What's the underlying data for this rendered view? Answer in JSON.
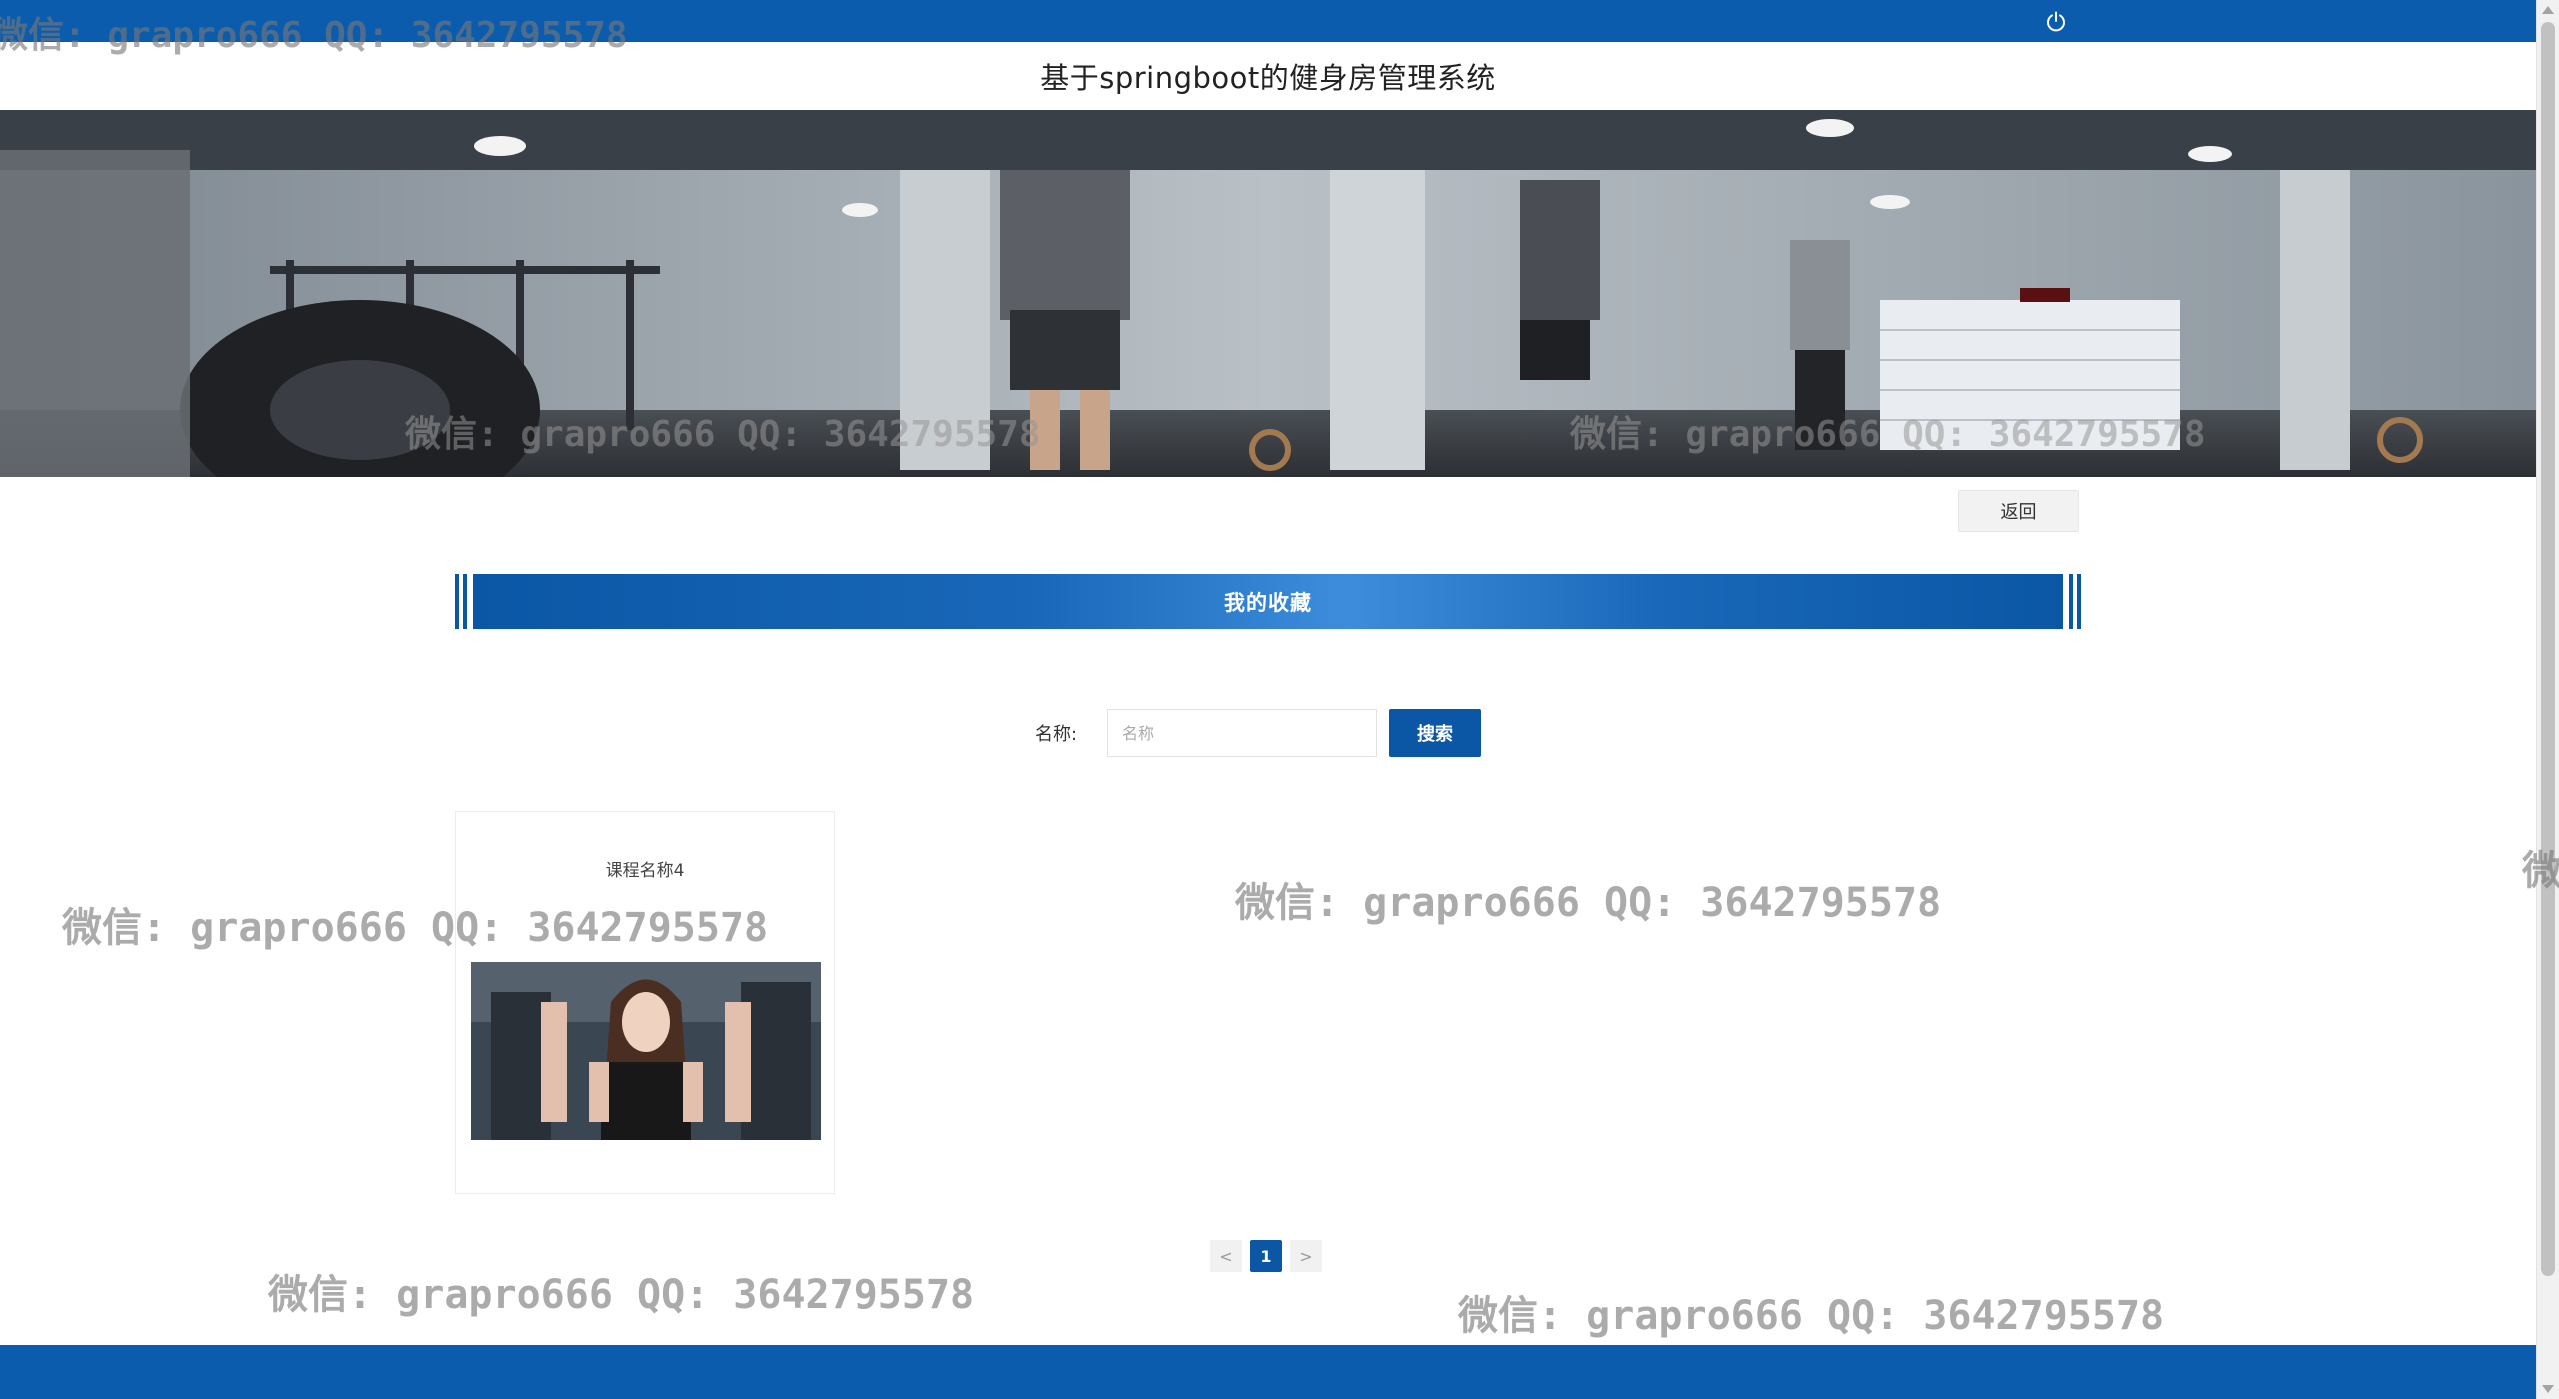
{
  "header": {
    "site_title": "基于springboot的健身房管理系统",
    "power_icon": "power-icon"
  },
  "nav": {
    "back_label": "返回"
  },
  "section": {
    "title": "我的收藏"
  },
  "search": {
    "label": "名称:",
    "placeholder": "名称",
    "value": "",
    "button_label": "搜索"
  },
  "favorites": [
    {
      "name": "课程名称4"
    }
  ],
  "pagination": {
    "prev": "<",
    "pages": [
      "1"
    ],
    "current": "1",
    "next": ">"
  },
  "watermark": {
    "text": "微信: grapro666 QQ: 3642795578",
    "fragment_top": "微信: grapro666 QQ: 3642795578",
    "fragment_right": "微"
  },
  "colors": {
    "primary_blue": "#0b5cad",
    "button_blue": "#0b57a6"
  }
}
